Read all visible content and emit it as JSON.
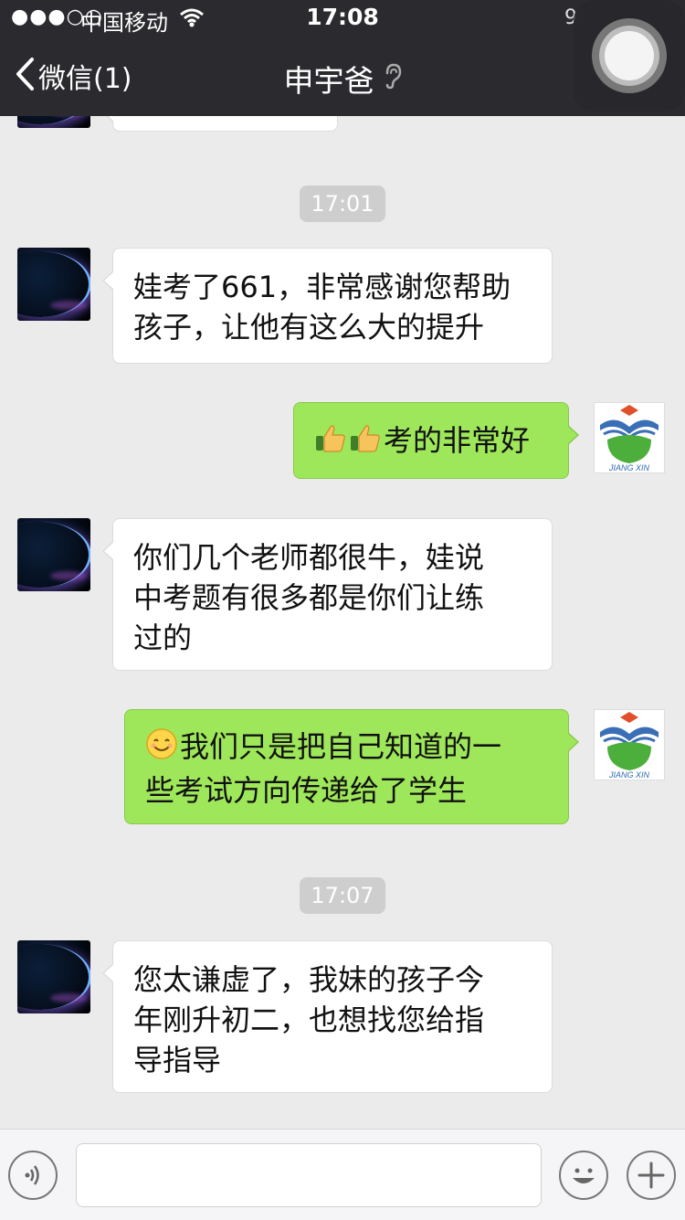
{
  "status_bar": {
    "signal": "●●●○○",
    "carrier": "中国移动",
    "time": "17:08",
    "battery_text": "9"
  },
  "nav": {
    "back_label": "微信(1)",
    "title": "申宇爸"
  },
  "chat": {
    "timestamps": [
      "17:01",
      "17:07"
    ],
    "messages": [
      {
        "side": "left",
        "lines": [
          "娃考了661，非常感谢您帮助",
          "孩子，让他有这么大的提升"
        ]
      },
      {
        "side": "right",
        "emoji": "thumbs-up x2",
        "text": "考的非常好"
      },
      {
        "side": "left",
        "lines": [
          "你们几个老师都很牛，娃说",
          "中考题有很多都是你们让练",
          "过的"
        ]
      },
      {
        "side": "right",
        "emoji": "smile",
        "lines": [
          "我们只是把自己知道的一",
          "些考试方向传递给了学生"
        ]
      },
      {
        "side": "left",
        "lines": [
          "您太谦虚了，我妹的孩子今",
          "年刚升初二，也想找您给指",
          "导指导"
        ]
      }
    ]
  },
  "avatar_logo_text": "JIANG XIN",
  "colors": {
    "nav_bg": "#2b2b2f",
    "chat_bg": "#ebebeb",
    "bubble_self": "#9fe75a",
    "bubble_other": "#ffffff"
  },
  "input": {
    "placeholder": ""
  }
}
